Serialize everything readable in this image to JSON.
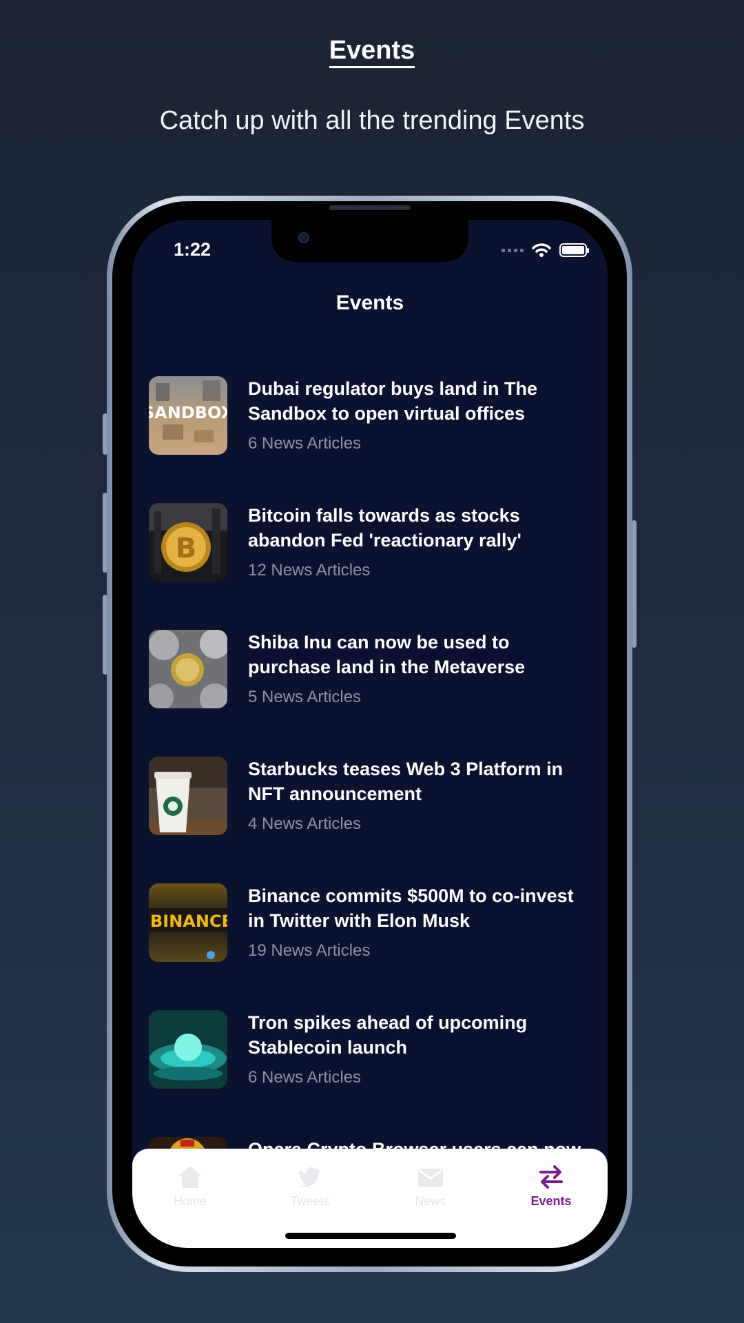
{
  "promo": {
    "title": "Events",
    "subtitle": "Catch up with all the trending Events"
  },
  "status_bar": {
    "time": "1:22"
  },
  "screen": {
    "title": "Events"
  },
  "events": [
    {
      "title": "Dubai regulator buys land in The Sandbox to open virtual offices",
      "count": "6 News Articles",
      "thumb_text": "SANDBOX"
    },
    {
      "title": "Bitcoin falls towards as stocks abandon Fed 'reactionary rally'",
      "count": "12 News Articles",
      "thumb_text": ""
    },
    {
      "title": "Shiba Inu can now be used to purchase land in the Metaverse",
      "count": "5 News Articles",
      "thumb_text": ""
    },
    {
      "title": "Starbucks teases Web 3 Platform in NFT announcement",
      "count": "4 News Articles",
      "thumb_text": ""
    },
    {
      "title": "Binance commits $500M to co-invest in Twitter with Elon Musk",
      "count": "19 News Articles",
      "thumb_text": "BINANCE"
    },
    {
      "title": "Tron spikes ahead of upcoming Stablecoin launch",
      "count": "6 News Articles",
      "thumb_text": ""
    },
    {
      "title": "Opera Crypto Browser users can now",
      "count": "",
      "thumb_text": ""
    }
  ],
  "tabs": [
    {
      "label": "Home",
      "icon": "home-icon",
      "active": false
    },
    {
      "label": "Tweets",
      "icon": "twitter-icon",
      "active": false
    },
    {
      "label": "News",
      "icon": "mail-icon",
      "active": false
    },
    {
      "label": "Events",
      "icon": "swap-arrows-icon",
      "active": true
    }
  ],
  "colors": {
    "background": "#1f2c42",
    "screen_bg": "#0a1230",
    "active_tab": "#7b1a8c",
    "muted_text": "#8d93a5"
  }
}
